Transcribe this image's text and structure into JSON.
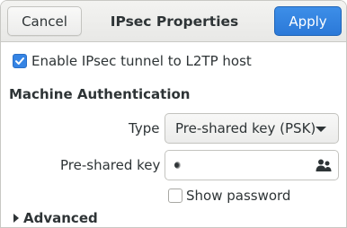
{
  "dialog": {
    "title": "IPsec Properties",
    "cancel_label": "Cancel",
    "apply_label": "Apply",
    "accent_color": "#3584e4"
  },
  "ipsec": {
    "enable_label": "Enable IPsec tunnel to L2TP host",
    "enabled": true
  },
  "machine_auth": {
    "section_title": "Machine Authentication",
    "type_label": "Type",
    "type_value": "Pre-shared key (PSK)",
    "psk_label": "Pre-shared key",
    "psk_value": "",
    "psk_icon": "users-icon",
    "show_password_label": "Show password",
    "show_password": false
  },
  "advanced": {
    "label": "Advanced",
    "expanded": false
  }
}
